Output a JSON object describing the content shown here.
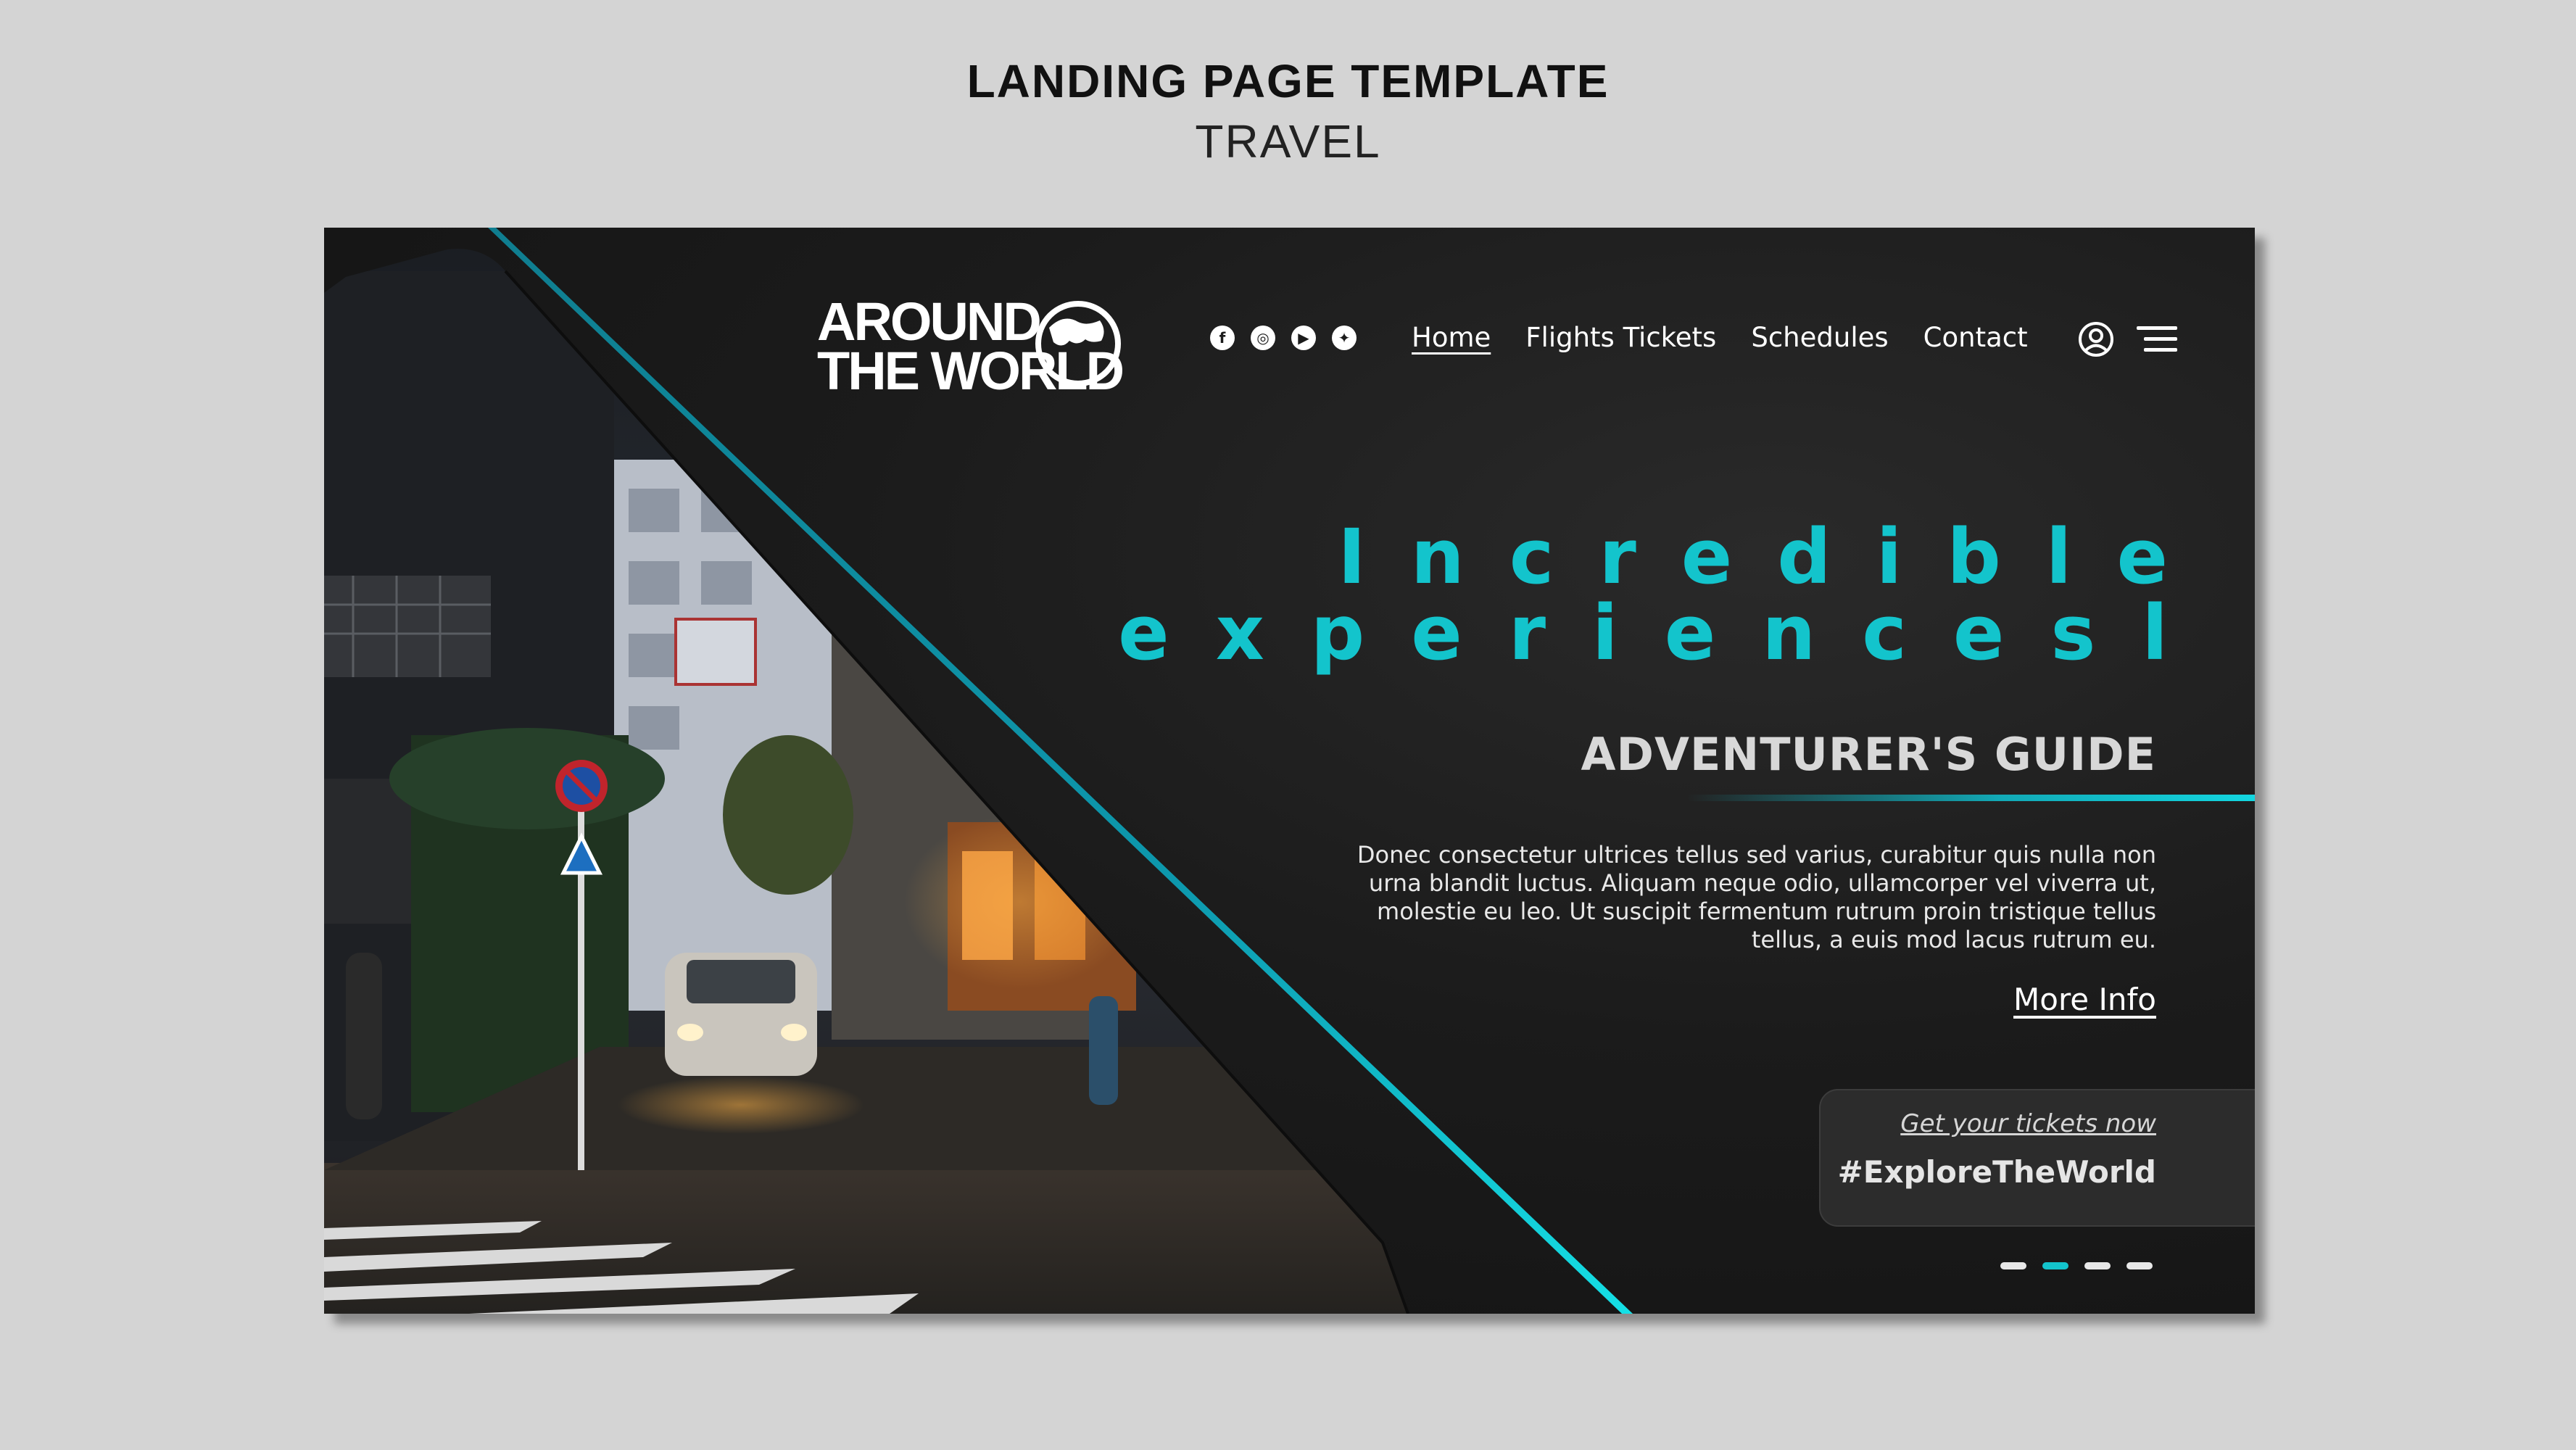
{
  "template": {
    "title": "LANDING PAGE TEMPLATE",
    "subtitle": "TRAVEL"
  },
  "brand": {
    "line1": "AROUND",
    "line2": "THE WORLD",
    "accent": "#13c4cc"
  },
  "social": [
    {
      "icon": "facebook-icon",
      "glyph": "f"
    },
    {
      "icon": "instagram-icon",
      "glyph": "◎"
    },
    {
      "icon": "youtube-icon",
      "glyph": "▶"
    },
    {
      "icon": "twitter-icon",
      "glyph": "✦"
    }
  ],
  "nav": {
    "items": [
      {
        "label": "Home",
        "active": true
      },
      {
        "label": "Flights Tickets",
        "active": false
      },
      {
        "label": "Schedules",
        "active": false
      },
      {
        "label": "Contact",
        "active": false
      }
    ]
  },
  "hero": {
    "headline_line1": "Incredible",
    "headline_line2": "experiencesl",
    "section_title": "ADVENTURER'S GUIDE",
    "paragraph": "Donec consectetur ultrices tellus sed varius, curabitur quis nulla non urna blandit luctus. Aliquam neque odio, ullamcorper vel viverra ut, molestie eu leo. Ut suscipit fermentum rutrum proin tristique tellus tellus, a euis mod lacus rutrum eu.",
    "more_link": "More Info"
  },
  "tickets": {
    "link": "Get your tickets now",
    "hashtag": "#ExploreTheWorld"
  },
  "carousel": {
    "count": 4,
    "active_index": 1
  }
}
